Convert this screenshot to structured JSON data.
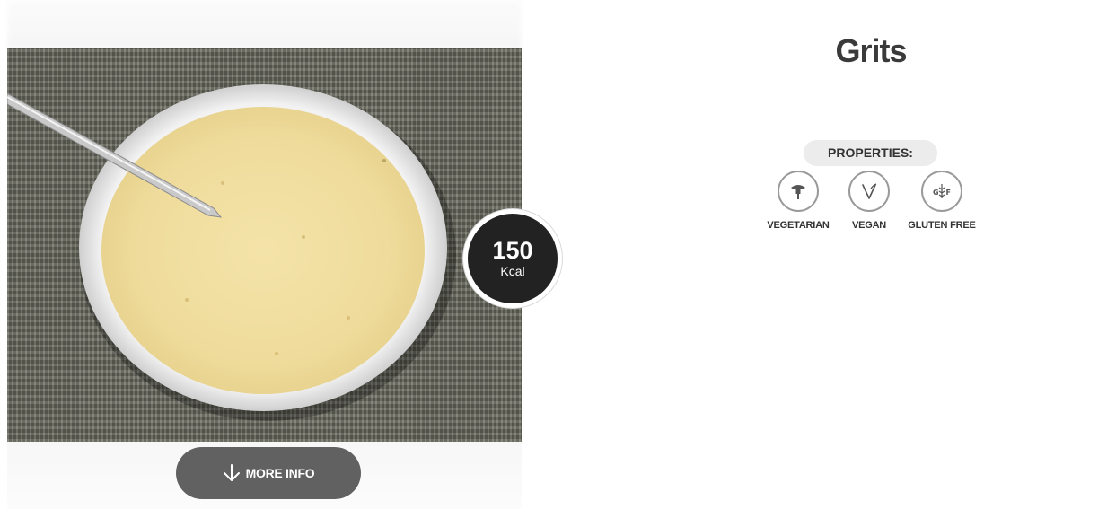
{
  "dish": {
    "title": "Grits",
    "calories": {
      "value": "150",
      "unit": "Kcal"
    }
  },
  "actions": {
    "more_info_label": "MORE INFO"
  },
  "properties": {
    "heading": "PROPERTIES:",
    "items": [
      {
        "label": "VEGETARIAN",
        "icon": "vegetarian-icon"
      },
      {
        "label": "VEGAN",
        "icon": "vegan-leaf-icon"
      },
      {
        "label": "GLUTEN FREE",
        "icon": "gluten-free-icon"
      }
    ]
  },
  "colors": {
    "badge_bg": "#222222",
    "button_bg": "#616161",
    "title_text": "#3a3a3a",
    "pill_bg": "#ececec",
    "icon_ring": "#9a9a9a"
  }
}
